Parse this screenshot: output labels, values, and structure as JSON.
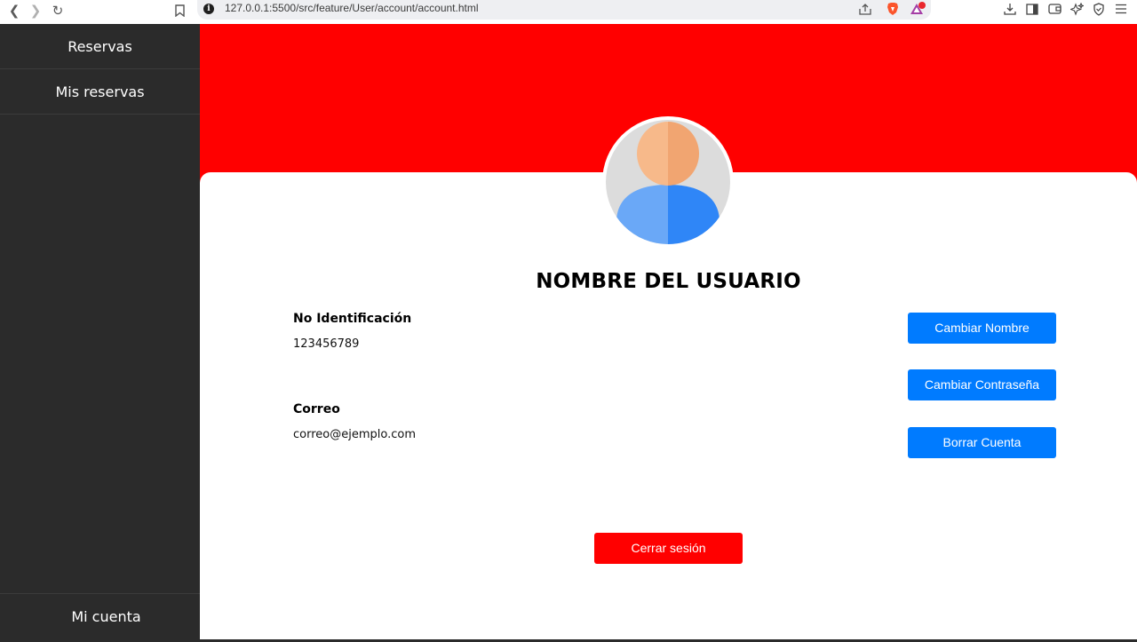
{
  "browser": {
    "url": "127.0.0.1:5500/src/feature/User/account/account.html",
    "info_icon_glyph": "i"
  },
  "sidebar": {
    "items": [
      {
        "label": "Reservas"
      },
      {
        "label": "Mis reservas"
      }
    ],
    "bottom_label": "Mi cuenta"
  },
  "profile": {
    "title": "NOMBRE DEL USUARIO",
    "id_label": "No Identificación",
    "id_value": "123456789",
    "email_label": "Correo",
    "email_value": "correo@ejemplo.com"
  },
  "actions": {
    "change_name": "Cambiar Nombre",
    "change_password": "Cambiar Contraseña",
    "delete_account": "Borrar Cuenta",
    "logout": "Cerrar sesión"
  },
  "colors": {
    "banner": "#ff0000",
    "primary_button": "#007bff",
    "logout_button": "#ff0000",
    "sidebar_bg": "#2b2b2b"
  },
  "icons": {
    "back": "back-arrow-icon",
    "forward": "forward-arrow-icon",
    "reload": "reload-icon",
    "bookmark": "bookmark-icon",
    "share": "share-icon",
    "brave": "brave-shield-icon",
    "rewards": "rewards-icon",
    "download": "download-icon",
    "sidebar": "sidebar-icon",
    "wallet": "wallet-icon",
    "leo": "leo-ai-icon",
    "vpn": "vpn-icon",
    "menu": "menu-icon"
  }
}
